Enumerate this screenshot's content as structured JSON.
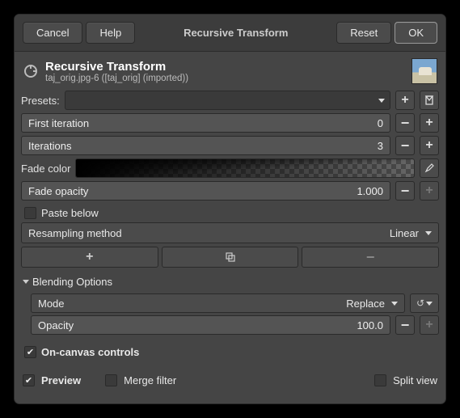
{
  "topbar": {
    "cancel": "Cancel",
    "help": "Help",
    "title": "Recursive Transform",
    "reset": "Reset",
    "ok": "OK"
  },
  "header": {
    "title": "Recursive Transform",
    "subtitle": "taj_orig.jpg-6 ([taj_orig] (imported))"
  },
  "presets": {
    "label": "Presets:"
  },
  "fields": {
    "first_iteration_label": "First iteration",
    "first_iteration_value": "0",
    "iterations_label": "Iterations",
    "iterations_value": "3",
    "fade_color_label": "Fade color",
    "fade_opacity_label": "Fade opacity",
    "fade_opacity_value": "1.000",
    "paste_below_label": "Paste below",
    "resampling_label": "Resampling method",
    "resampling_value": "Linear"
  },
  "blending": {
    "label": "Blending Options",
    "mode_label": "Mode",
    "mode_value": "Replace",
    "opacity_label": "Opacity",
    "opacity_value": "100.0"
  },
  "footer": {
    "on_canvas": "On-canvas controls",
    "preview": "Preview",
    "merge_filter": "Merge filter",
    "split_view": "Split view"
  }
}
